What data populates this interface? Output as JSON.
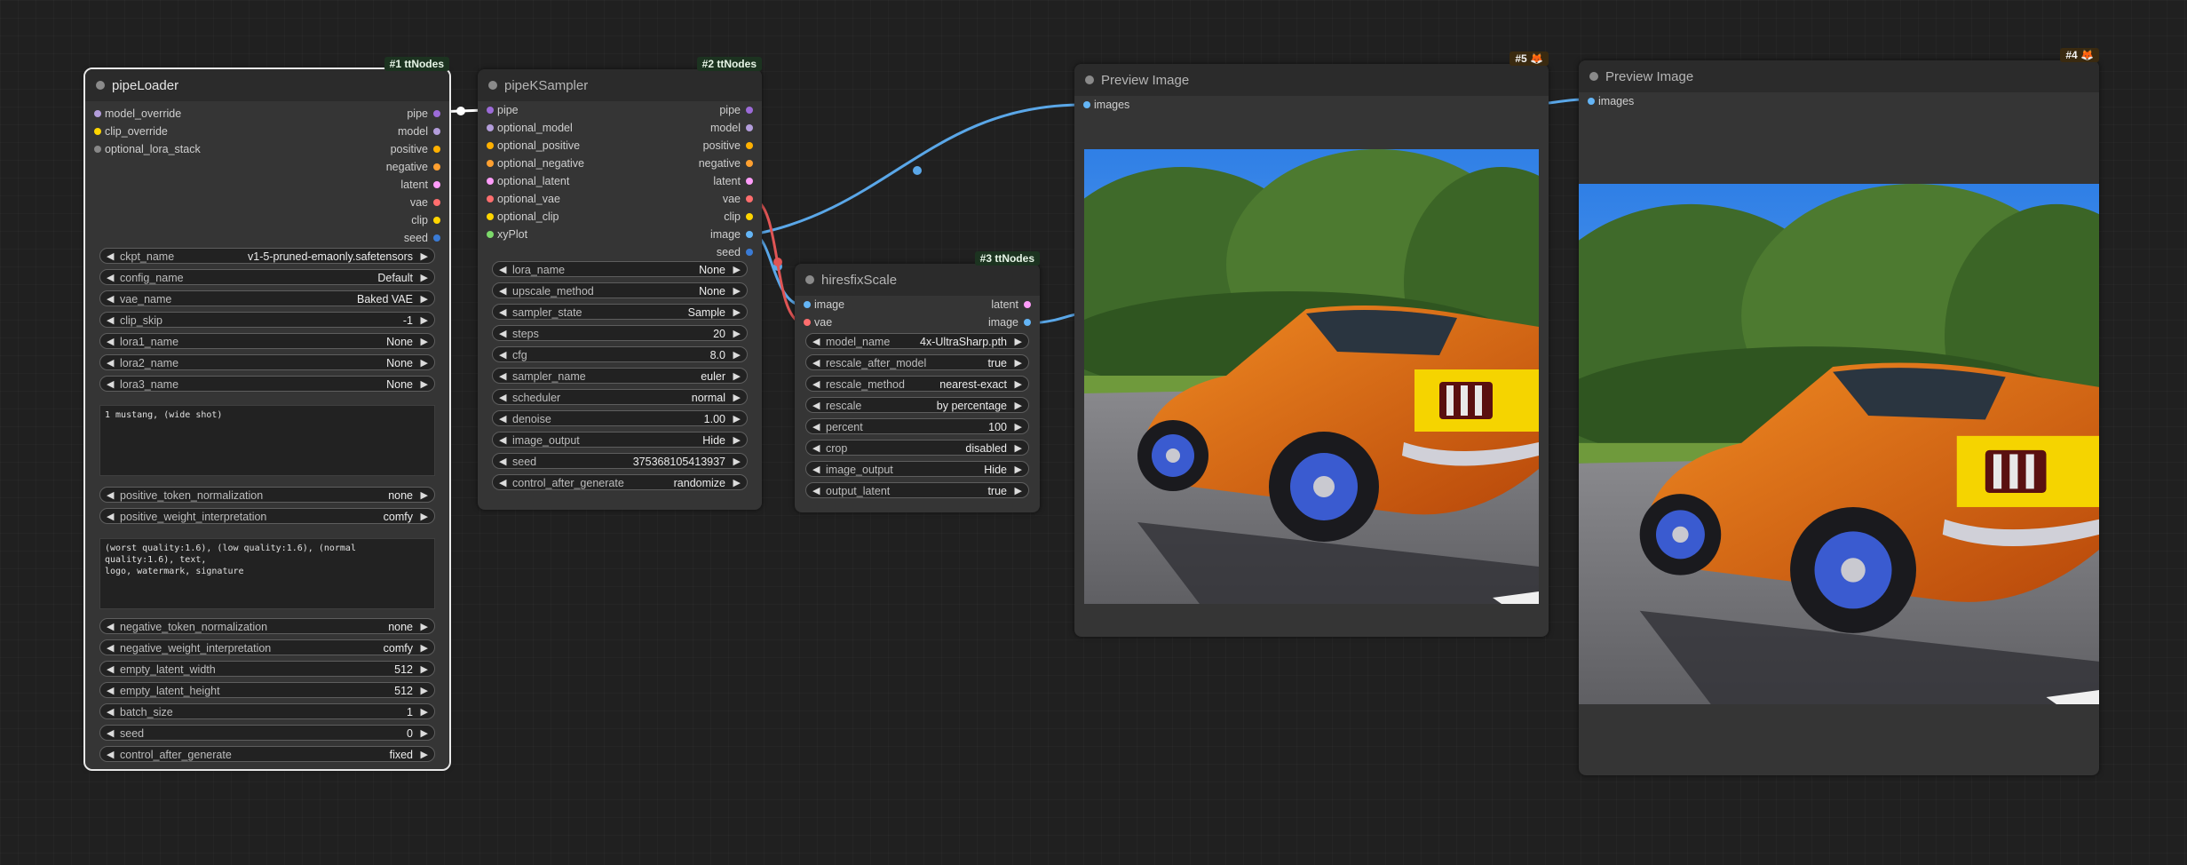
{
  "colors": {
    "pipe": "#9c6bd8",
    "model": "#b39ddb",
    "positive": "#ffb000",
    "negative": "#ffa030",
    "latent": "#ff9cf9",
    "vae": "#ff6e6e",
    "clip": "#ffd500",
    "seed": "#3a7bd5",
    "image": "#64b5f6",
    "lora": "#888888",
    "xyplot": "#7cd96a",
    "link_image": "#5aa7e8",
    "link_vae": "#e05555",
    "link_pipe": "#ffffff"
  },
  "nodes": {
    "loader": {
      "title": "pipeLoader",
      "badge": "#1 ttNodes",
      "inputs": [
        "model_override",
        "clip_override",
        "optional_lora_stack"
      ],
      "outputs": [
        "pipe",
        "model",
        "positive",
        "negative",
        "latent",
        "vae",
        "clip",
        "seed"
      ],
      "widgets1": [
        {
          "label": "ckpt_name",
          "value": "v1-5-pruned-emaonly.safetensors"
        },
        {
          "label": "config_name",
          "value": "Default"
        },
        {
          "label": "vae_name",
          "value": "Baked VAE"
        },
        {
          "label": "clip_skip",
          "value": "-1"
        },
        {
          "label": "lora1_name",
          "value": "None"
        },
        {
          "label": "lora2_name",
          "value": "None"
        },
        {
          "label": "lora3_name",
          "value": "None"
        }
      ],
      "positive_prompt": "1 mustang, (wide shot)",
      "widgets2": [
        {
          "label": "positive_token_normalization",
          "value": "none"
        },
        {
          "label": "positive_weight_interpretation",
          "value": "comfy"
        }
      ],
      "negative_prompt": "(worst quality:1.6), (low quality:1.6), (normal quality:1.6), text,\nlogo, watermark, signature",
      "widgets3": [
        {
          "label": "negative_token_normalization",
          "value": "none"
        },
        {
          "label": "negative_weight_interpretation",
          "value": "comfy"
        },
        {
          "label": "empty_latent_width",
          "value": "512"
        },
        {
          "label": "empty_latent_height",
          "value": "512"
        },
        {
          "label": "batch_size",
          "value": "1"
        },
        {
          "label": "seed",
          "value": "0"
        },
        {
          "label": "control_after_generate",
          "value": "fixed"
        }
      ]
    },
    "sampler": {
      "title": "pipeKSampler",
      "badge": "#2 ttNodes",
      "inputs": [
        "pipe",
        "optional_model",
        "optional_positive",
        "optional_negative",
        "optional_latent",
        "optional_vae",
        "optional_clip",
        "xyPlot"
      ],
      "outputs": [
        "pipe",
        "model",
        "positive",
        "negative",
        "latent",
        "vae",
        "clip",
        "image",
        "seed"
      ],
      "widgets": [
        {
          "label": "lora_name",
          "value": "None"
        },
        {
          "label": "upscale_method",
          "value": "None"
        },
        {
          "label": "sampler_state",
          "value": "Sample"
        },
        {
          "label": "steps",
          "value": "20"
        },
        {
          "label": "cfg",
          "value": "8.0"
        },
        {
          "label": "sampler_name",
          "value": "euler"
        },
        {
          "label": "scheduler",
          "value": "normal"
        },
        {
          "label": "denoise",
          "value": "1.00"
        },
        {
          "label": "image_output",
          "value": "Hide"
        },
        {
          "label": "seed",
          "value": "375368105413937"
        },
        {
          "label": "control_after_generate",
          "value": "randomize"
        }
      ]
    },
    "hires": {
      "title": "hiresfixScale",
      "badge": "#3 ttNodes",
      "inputs": [
        "image",
        "vae"
      ],
      "outputs": [
        "latent",
        "image"
      ],
      "widgets": [
        {
          "label": "model_name",
          "value": "4x-UltraSharp.pth"
        },
        {
          "label": "rescale_after_model",
          "value": "true"
        },
        {
          "label": "rescale_method",
          "value": "nearest-exact"
        },
        {
          "label": "rescale",
          "value": "by percentage"
        },
        {
          "label": "percent",
          "value": "100"
        },
        {
          "label": "crop",
          "value": "disabled"
        },
        {
          "label": "image_output",
          "value": "Hide"
        },
        {
          "label": "output_latent",
          "value": "true"
        }
      ]
    },
    "preview5": {
      "title": "Preview Image",
      "badge": "#5 🦊",
      "inputs": [
        "images"
      ]
    },
    "preview4": {
      "title": "Preview Image",
      "badge": "#4 🦊",
      "inputs": [
        "images"
      ]
    }
  }
}
